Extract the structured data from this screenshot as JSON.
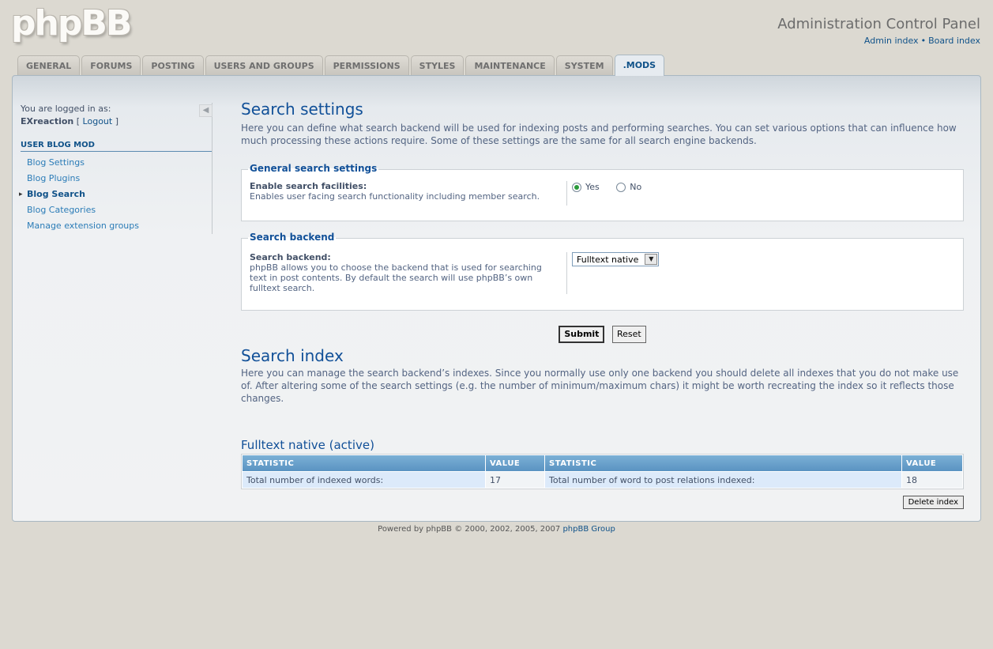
{
  "header": {
    "logo_text": "phpBB",
    "acp_title": "Administration Control Panel",
    "links": [
      "Admin index",
      "Board index"
    ],
    "separator": "•"
  },
  "tabs": [
    "GENERAL",
    "FORUMS",
    "POSTING",
    "USERS AND GROUPS",
    "PERMISSIONS",
    "STYLES",
    "MAINTENANCE",
    "SYSTEM",
    ".MODS"
  ],
  "active_tab": ".MODS",
  "sidebar": {
    "logged_in_label": "You are logged in as:",
    "username": "EXreaction",
    "logout_open": "[",
    "logout_label": "Logout",
    "logout_close": "]",
    "section_title": "USER BLOG MOD",
    "items": [
      "Blog Settings",
      "Blog Plugins",
      "Blog Search",
      "Blog Categories",
      "Manage extension groups"
    ],
    "active_item": "Blog Search"
  },
  "search_settings": {
    "title": "Search settings",
    "description": "Here you can define what search backend will be used for indexing posts and performing searches. You can set various options that can influence how much processing these actions require. Some of these settings are the same for all search engine backends."
  },
  "general_fieldset": {
    "legend": "General search settings",
    "label": "Enable search facilities:",
    "explain": "Enables user facing search functionality including member search.",
    "options": [
      "Yes",
      "No"
    ],
    "selected": "Yes"
  },
  "backend_fieldset": {
    "legend": "Search backend",
    "label": "Search backend:",
    "explain": "phpBB allows you to choose the backend that is used for searching text in post contents. By default the search will use phpBB’s own fulltext search.",
    "selected_value": "Fulltext native"
  },
  "buttons": {
    "submit": "Submit",
    "reset": "Reset"
  },
  "search_index": {
    "title": "Search index",
    "description": "Here you can manage the search backend’s indexes. Since you normally use only one backend you should delete all indexes that you do not make use of. After altering some of the search settings (e.g. the number of minimum/maximum chars) it might be worth recreating the index so it reflects those changes."
  },
  "index_section": {
    "title": "Fulltext native (active)",
    "headers": [
      "STATISTIC",
      "VALUE",
      "STATISTIC",
      "VALUE"
    ],
    "row": [
      "Total number of indexed words:",
      "17",
      "Total number of word to post relations indexed:",
      "18"
    ],
    "delete_label": "Delete index"
  },
  "footer": {
    "prefix": "Powered by phpBB © 2000, 2002, 2005, 2007",
    "link": "phpBB Group"
  }
}
